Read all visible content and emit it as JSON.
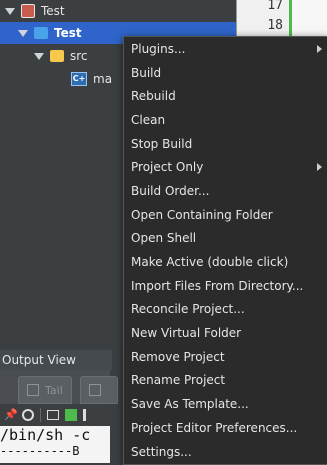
{
  "tree": {
    "workspace_label": "Test",
    "project_label": "Test",
    "folder_label": "src",
    "file_label": "ma"
  },
  "editor": {
    "line_numbers": [
      "17",
      "18"
    ]
  },
  "output": {
    "title": "Output View",
    "tab_label": "Tail",
    "console_line1": "/bin/sh -c",
    "console_line2": "----------B"
  },
  "menu": {
    "items": [
      {
        "label": "Plugins...",
        "submenu": true
      },
      {
        "label": "Build"
      },
      {
        "label": "Rebuild"
      },
      {
        "label": "Clean"
      },
      {
        "label": "Stop Build"
      },
      {
        "label": "Project Only",
        "submenu": true
      },
      {
        "label": "Build Order..."
      },
      {
        "label": "Open Containing Folder"
      },
      {
        "label": "Open Shell"
      },
      {
        "label": "Make Active (double click)"
      },
      {
        "label": "Import Files From Directory..."
      },
      {
        "label": "Reconcile Project..."
      },
      {
        "label": "New Virtual Folder"
      },
      {
        "label": "Remove Project"
      },
      {
        "label": "Rename Project"
      },
      {
        "label": "Save As Template..."
      },
      {
        "label": "Project Editor Preferences..."
      },
      {
        "label": "Settings..."
      }
    ]
  },
  "colors": {
    "selection": "#2f65ca",
    "menu_bg": "#2b2b2b",
    "panel_bg": "#3c3f41"
  }
}
